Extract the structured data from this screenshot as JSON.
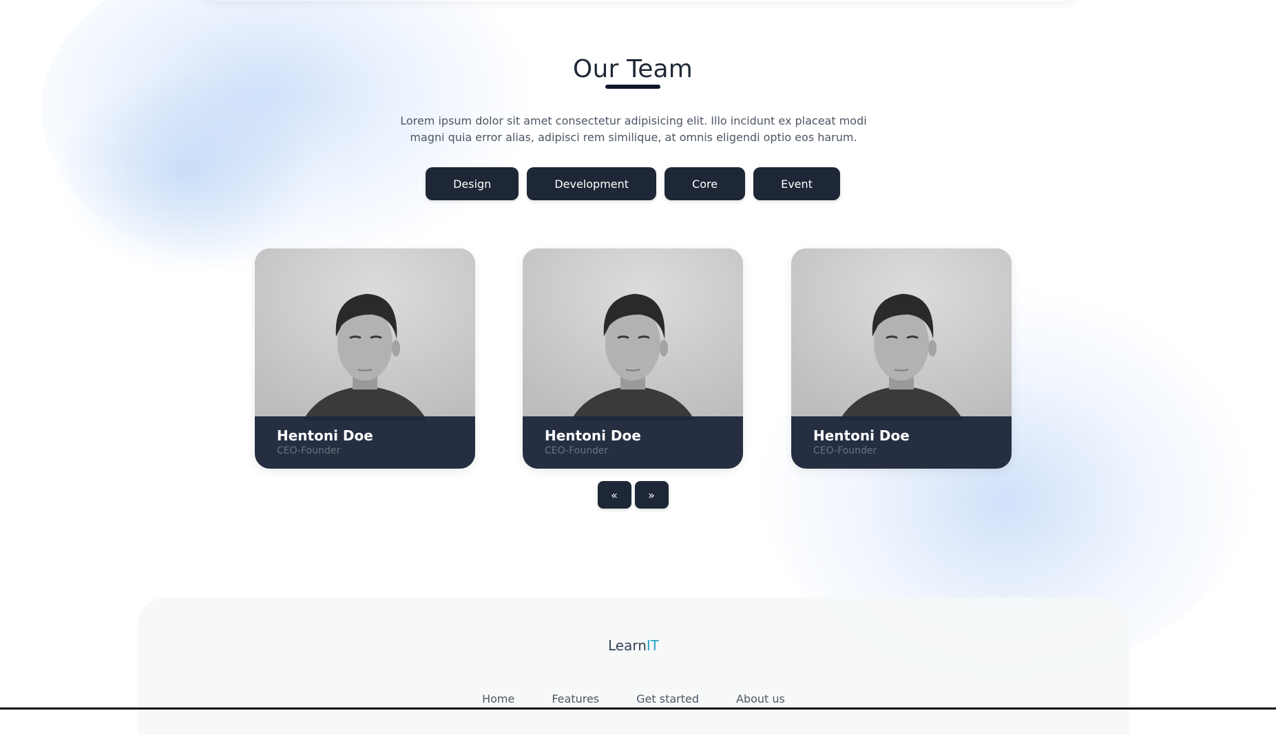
{
  "section": {
    "title": "Our Team",
    "description": "Lorem ipsum dolor sit amet consectetur adipisicing elit. Illo incidunt ex placeat modi magni quia error alias, adipisci rem similique, at omnis eligendi optio eos harum."
  },
  "filters": [
    "Design",
    "Development",
    "Core",
    "Event"
  ],
  "team": [
    {
      "name": "Hentoni Doe",
      "role": "CEO-Founder"
    },
    {
      "name": "Hentoni Doe",
      "role": "CEO-Founder"
    },
    {
      "name": "Hentoni Doe",
      "role": "CEO-Founder"
    }
  ],
  "pager": {
    "prev": "«",
    "next": "»"
  },
  "footer": {
    "brand_main": "Learn",
    "brand_accent": "IT",
    "links": [
      "Home",
      "Features",
      "Get started",
      "About us"
    ]
  },
  "colors": {
    "button_bg": "#1e2736",
    "card_info_bg": "#1e293b",
    "brand_accent": "#2aa4c4",
    "blob": "#aac8f5"
  }
}
